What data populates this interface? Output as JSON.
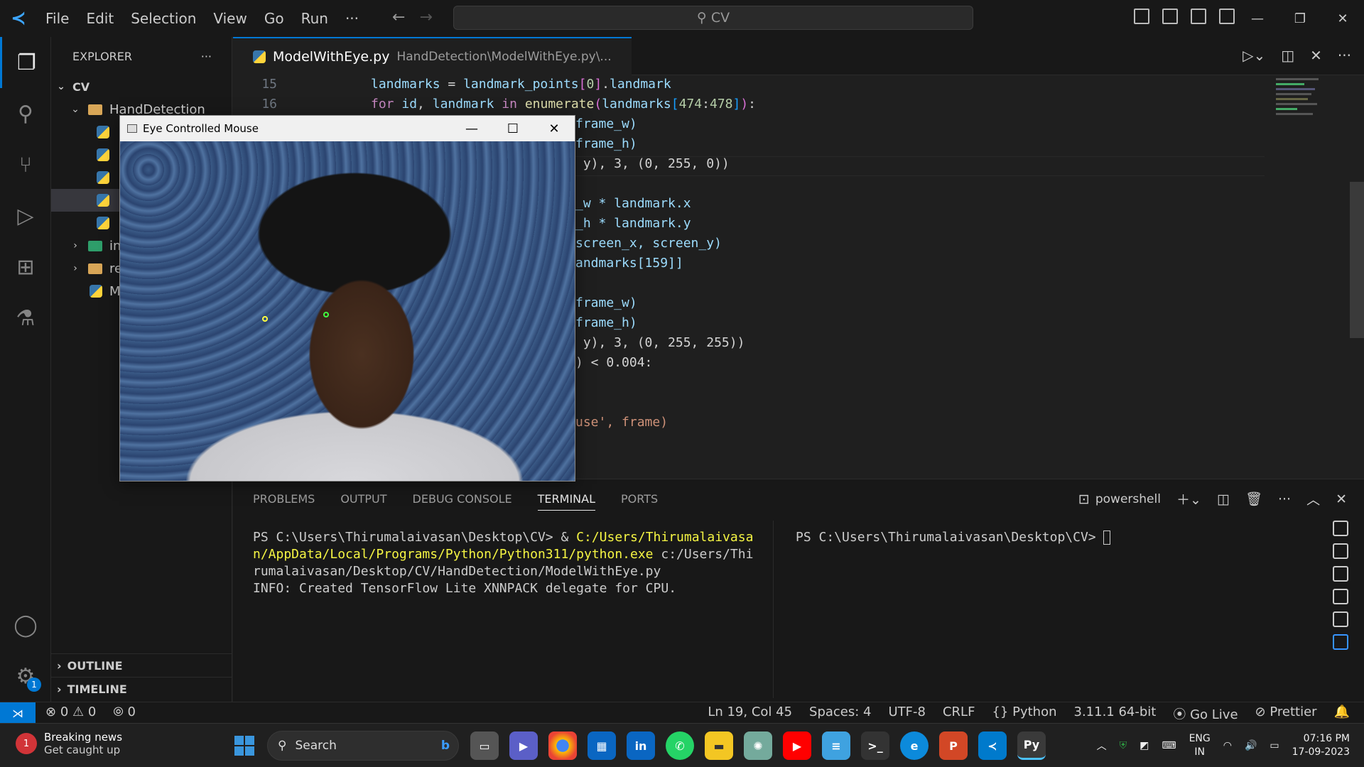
{
  "titlebar": {
    "menu": [
      "File",
      "Edit",
      "Selection",
      "View",
      "Go",
      "Run",
      "···"
    ],
    "search_text": "CV"
  },
  "explorer": {
    "title": "EXPLORER",
    "more": "···",
    "root": "CV",
    "folder": "HandDetection",
    "items_partial": [
      "in",
      "re",
      "M"
    ],
    "outline": "OUTLINE",
    "timeline": "TIMELINE"
  },
  "tab": {
    "filename": "ModelWithEye.py",
    "path": "HandDetection\\ModelWithEye.py\\..."
  },
  "code": {
    "line15_num": "15",
    "line16_num": "16",
    "lines": [
      "frame_w)",
      "frame_h)",
      " y), 3, (0, 255, 0))",
      "",
      "_w * landmark.x",
      "_h * landmark.y",
      "screen_x, screen_y)",
      "andmarks[159]]",
      "",
      "frame_w)",
      "frame_h)",
      " y), 3, (0, 255, 255))",
      ") < 0.004:",
      "",
      "",
      "use', frame)"
    ]
  },
  "camera_window": {
    "title": "Eye Controlled Mouse"
  },
  "panel": {
    "tabs": [
      "PROBLEMS",
      "OUTPUT",
      "DEBUG CONSOLE",
      "TERMINAL",
      "PORTS"
    ],
    "active_tab": "TERMINAL",
    "shell": "powershell",
    "term1_prompt": "PS C:\\Users\\Thirumalaivasan\\Desktop\\CV> & ",
    "term1_exe_a": "C:/Users/Thirumalaivasa",
    "term1_exe_b": "n/AppData/Local/Programs/Python/Python311/python.exe",
    "term1_arg_a": " c:/Users/Thi",
    "term1_arg_b": "rumalaivasan/Desktop/CV/HandDetection/ModelWithEye.py",
    "term1_info": "INFO: Created TensorFlow Lite XNNPACK delegate for CPU.",
    "term2_prompt": "PS C:\\Users\\Thirumalaivasan\\Desktop\\CV> "
  },
  "status": {
    "errors": "0",
    "warnings": "0",
    "ports": "0",
    "position": "Ln 19, Col 45",
    "spaces": "Spaces: 4",
    "encoding": "UTF-8",
    "eol": "CRLF",
    "language": "Python",
    "interpreter": "3.11.1 64-bit",
    "golive": "Go Live",
    "prettier": "Prettier"
  },
  "activity": {
    "settings_badge": "1"
  },
  "taskbar": {
    "news_badge": "1",
    "news_title": "Breaking news",
    "news_sub": "Get caught up",
    "search": "Search",
    "lang_top": "ENG",
    "lang_bottom": "IN",
    "time": "07:16 PM",
    "date": "17-09-2023"
  }
}
